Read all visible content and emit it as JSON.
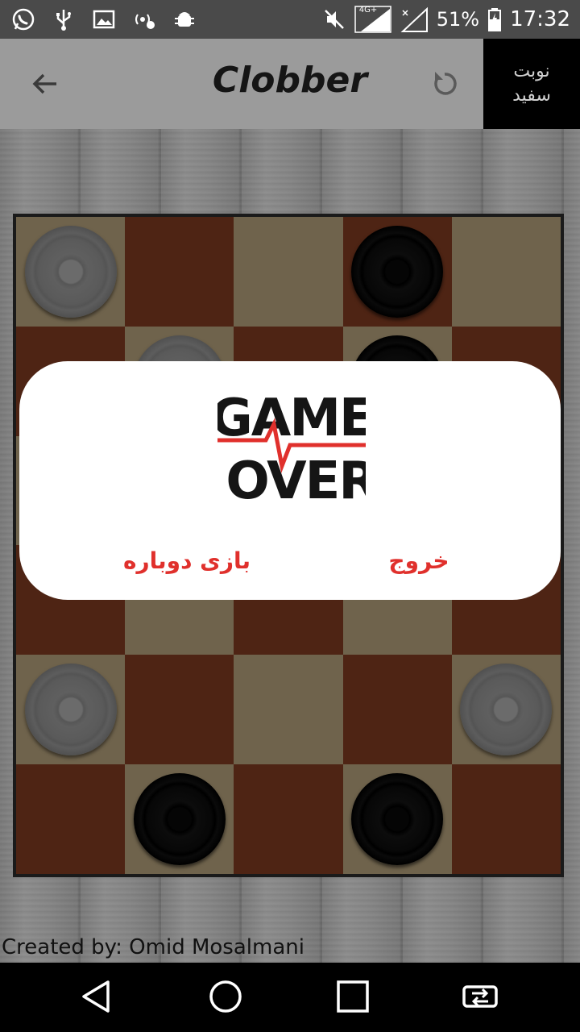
{
  "status_bar": {
    "battery": "51%",
    "time": "17:32",
    "network_badge": "4G+",
    "left_icons": [
      "whatsapp-icon",
      "usb-icon",
      "image-icon",
      "hotspot-icon",
      "android-debug-icon"
    ],
    "right_icons": [
      "mute-icon",
      "signal-sim1-icon",
      "signal-sim2-icon",
      "battery-charging-icon"
    ]
  },
  "app_bar": {
    "title": "Clobber",
    "turn_line1": "نوبت",
    "turn_line2": "سفید",
    "back_icon": "arrow-back-icon",
    "reload_icon": "reload-icon"
  },
  "board": {
    "columns": 5,
    "rows": 6,
    "cells": [
      [
        "white",
        "",
        "",
        "black",
        ""
      ],
      [
        "",
        "white",
        "",
        "black",
        ""
      ],
      [
        "",
        "",
        "",
        "",
        ""
      ],
      [
        "",
        "",
        "",
        "",
        ""
      ],
      [
        "white",
        "",
        "",
        "",
        "white"
      ],
      [
        "",
        "black",
        "",
        "black",
        ""
      ]
    ],
    "hidden_partial_white_row4_col3": true
  },
  "dialog": {
    "logo_line1": "GAME",
    "logo_line2": "OVER",
    "replay_label": "بازی دوباره",
    "exit_label": "خروج",
    "accent_color": "#e0302c"
  },
  "credit": "Created by: Omid Mosalmani",
  "nav_bar": {
    "icons": [
      "back-triangle-icon",
      "home-circle-icon",
      "recents-square-icon",
      "swap-icon"
    ]
  }
}
